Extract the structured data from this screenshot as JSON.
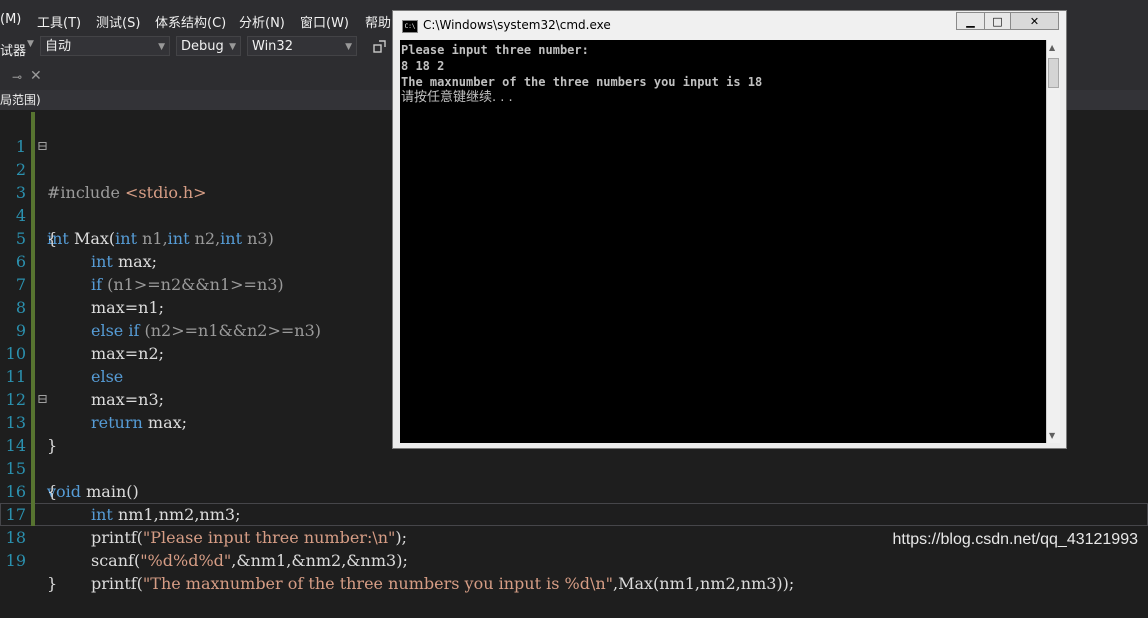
{
  "menu": [
    {
      "label": "(M)"
    },
    {
      "label": "工具(T)"
    },
    {
      "label": "测试(S)"
    },
    {
      "label": "体系结构(C)"
    },
    {
      "label": "分析(N)"
    },
    {
      "label": "窗口(W)"
    },
    {
      "label": "帮助("
    }
  ],
  "toolbar": {
    "debugger_label": "试器",
    "combo_auto": "自动",
    "combo_config": "Debug",
    "combo_platform": "Win32"
  },
  "scope": "局范围)",
  "code_lines": [
    {
      "n": "1"
    },
    {
      "n": "2"
    },
    {
      "n": "3"
    },
    {
      "n": "4"
    },
    {
      "n": "5"
    },
    {
      "n": "6"
    },
    {
      "n": "7"
    },
    {
      "n": "8"
    },
    {
      "n": "9"
    },
    {
      "n": "10"
    },
    {
      "n": "11"
    },
    {
      "n": "12"
    },
    {
      "n": "13"
    },
    {
      "n": "14"
    },
    {
      "n": "15"
    },
    {
      "n": "16"
    },
    {
      "n": "17"
    },
    {
      "n": "18"
    },
    {
      "n": "19"
    }
  ],
  "code": {
    "l1_pp": "#include ",
    "l1_hdr": "<stdio.h>",
    "l2_kw1": "int",
    "l2_rest1": " Max(",
    "l2_kw2": "int",
    "l2_p1": " n1,",
    "l2_kw3": "int",
    "l2_p2": " n2,",
    "l2_kw4": "int",
    "l2_p3": " n3)",
    "l3": "{",
    "l4_kw": "int",
    "l4_rest": " max;",
    "l5_kw": "if",
    "l5_rest": " (n1>=n2&&n1>=n3)",
    "l6": "max=n1;",
    "l7_kw1": "else",
    "l7_kw2": " if",
    "l7_rest": " (n2>=n1&&n2>=n3)",
    "l8": "max=n2;",
    "l9_kw": "else",
    "l10": "max=n3;",
    "l11_kw": "return",
    "l11_rest": " max;",
    "l12": "}",
    "l13_kw": "void",
    "l13_rest": " main()",
    "l14": "{",
    "l15_kw": "int",
    "l15_rest": " nm1,nm2,nm3;",
    "l16_fn": "printf(",
    "l16_str": "\"Please input three number:\\n\"",
    "l16_end": ");",
    "l17_fn": "scanf(",
    "l17_str": "\"%d%d%d\"",
    "l17_end": ",&nm1,&nm2,&nm3);",
    "l18_fn": "printf(",
    "l18_str": "\"The maxnumber of the three numbers you input is %d\\n\"",
    "l18_end": ",Max(nm1,nm2,nm3));",
    "l19": "}"
  },
  "cmd": {
    "title": "C:\\Windows\\system32\\cmd.exe",
    "output": [
      "Please input three number:",
      "8 18 2",
      "The maxnumber of the three numbers you input is 18",
      "请按任意键继续. . ."
    ]
  },
  "watermark": "https://blog.csdn.net/qq_43121993",
  "colors": {
    "background": "#1e1e1e",
    "keyword": "#569cd6",
    "string": "#d69d85",
    "line_number": "#2b91af",
    "change_bar": "#577430"
  }
}
